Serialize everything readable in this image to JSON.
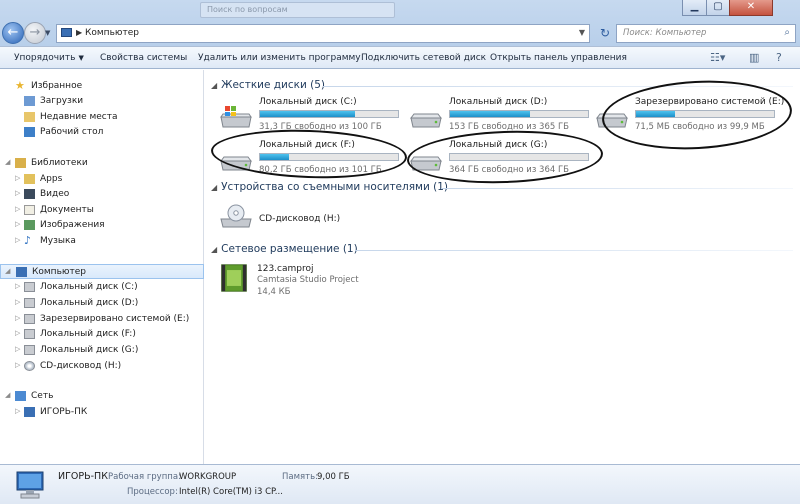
{
  "titlebar": {
    "search_ghost": "Поиск по вопросам"
  },
  "address": {
    "crumb": "Компьютер"
  },
  "search": {
    "placeholder": "Поиск: Компьютер"
  },
  "toolbar": {
    "organize": "Упорядочить",
    "properties": "Свойства системы",
    "uninstall": "Удалить или изменить программу",
    "map_drive": "Подключить сетевой диск",
    "control_panel": "Открыть панель управления"
  },
  "nav": {
    "favorites": "Избранное",
    "downloads": "Загрузки",
    "recent": "Недавние места",
    "desktop": "Рабочий стол",
    "libraries": "Библиотеки",
    "apps": "Apps",
    "video": "Видео",
    "documents": "Документы",
    "images": "Изображения",
    "music": "Музыка",
    "computer": "Компьютер",
    "drive_c": "Локальный диск (C:)",
    "drive_d": "Локальный диск (D:)",
    "drive_e": "Зарезервировано системой (E:)",
    "drive_f": "Локальный диск (F:)",
    "drive_g": "Локальный диск (G:)",
    "drive_h": "CD-дисковод (H:)",
    "network": "Сеть",
    "pc": "ИГОРЬ-ПК"
  },
  "groups": {
    "hard_disks": "Жесткие диски (5)",
    "removable": "Устройства со съемными носителями (1)",
    "network_location": "Сетевое размещение (1)"
  },
  "drives": [
    {
      "name": "Локальный диск (C:)",
      "free": "31,3 ГБ свободно из 100 ГБ",
      "used_fraction": 0.69
    },
    {
      "name": "Локальный диск (D:)",
      "free": "153 ГБ свободно из 365 ГБ",
      "used_fraction": 0.58
    },
    {
      "name": "Зарезервировано системой (E:)",
      "free": "71,5 МБ свободно из 99,9 МБ",
      "used_fraction": 0.28
    },
    {
      "name": "Локальный диск (F:)",
      "free": "80,2 ГБ свободно из 101 ГБ",
      "used_fraction": 0.21
    },
    {
      "name": "Локальный диск (G:)",
      "free": "364 ГБ свободно из 364 ГБ",
      "used_fraction": 0.0
    }
  ],
  "cd_drive": {
    "name": "CD-дисковод (H:)"
  },
  "net_item": {
    "name": "123.camproj",
    "type": "Camtasia Studio Project",
    "size": "14,4 КБ"
  },
  "details": {
    "pc_name": "ИГОРЬ-ПК",
    "workgroup_label": "Рабочая группа:",
    "workgroup_value": "WORKGROUP",
    "memory_label": "Память:",
    "memory_value": "9,00 ГБ",
    "cpu_label": "Процессор:",
    "cpu_value": "Intel(R) Core(TM) i3 CP..."
  },
  "colors": {
    "accent": "#1e395b",
    "bar_fill": "#1d8fc9"
  }
}
